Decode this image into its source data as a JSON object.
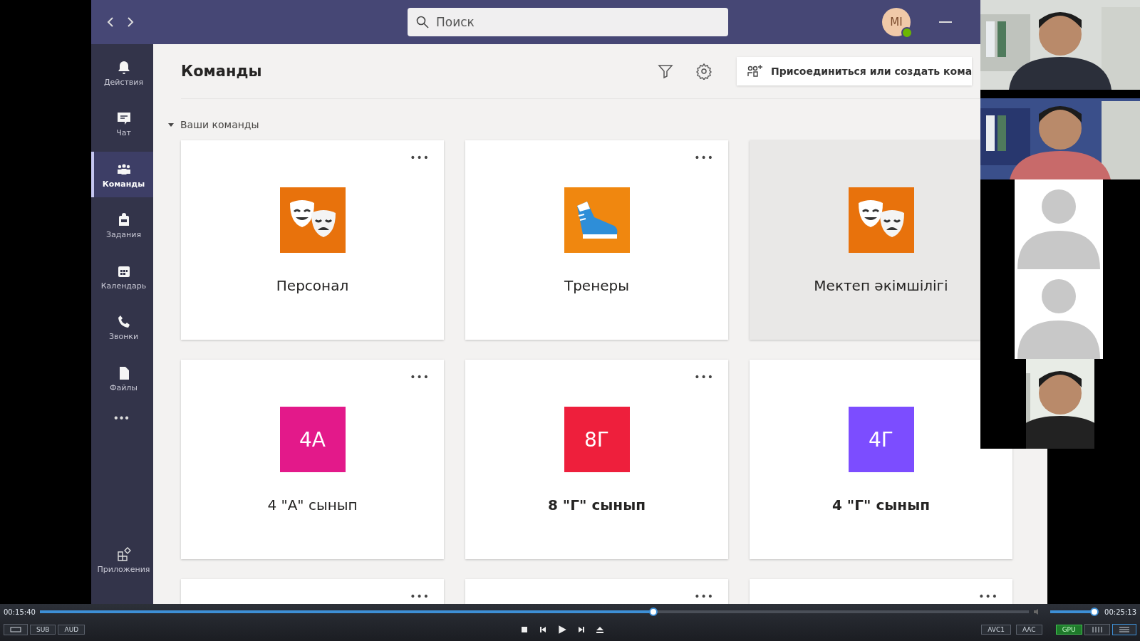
{
  "top_bar": {
    "search": {
      "placeholder": "Поиск"
    },
    "avatar": {
      "initials": "MI",
      "online": true
    }
  },
  "sidebar": {
    "items": [
      {
        "label": "Действия",
        "selected": false
      },
      {
        "label": "Чат",
        "selected": false
      },
      {
        "label": "Команды",
        "selected": true
      },
      {
        "label": "Задания",
        "selected": false
      },
      {
        "label": "Календарь",
        "selected": false
      },
      {
        "label": "Звонки",
        "selected": false
      },
      {
        "label": "Файлы",
        "selected": false
      }
    ],
    "more": "•••",
    "apps": {
      "label": "Приложения"
    }
  },
  "header": {
    "title": "Команды",
    "join_button": "Присоединиться или создать кома"
  },
  "section": {
    "title": "Ваши команды",
    "expanded": true
  },
  "teams": [
    {
      "name": "Персонал",
      "more": "•••",
      "kind": "masks",
      "color": "#e8720c",
      "bold": false,
      "hovered": false
    },
    {
      "name": "Тренеры",
      "more": "•••",
      "kind": "sneaker",
      "color": "#f0870f",
      "bold": false,
      "hovered": false
    },
    {
      "name": "Мектеп әкімшілігі",
      "kind": "masks",
      "color": "#e8720c",
      "bold": false,
      "hovered": true
    },
    {
      "name": "4 \"А\" сынып",
      "more": "•••",
      "kind": "initials",
      "tile": "4А",
      "color": "#e3198a",
      "bold": false,
      "hovered": false
    },
    {
      "name": "8 \"Г\" сынып",
      "more": "•••",
      "kind": "initials",
      "tile": "8Г",
      "color": "#ee1f3c",
      "bold": true,
      "hovered": false
    },
    {
      "name": "4 \"Г\" сынып",
      "kind": "initials",
      "tile": "4Г",
      "color": "#7c4dff",
      "bold": true,
      "hovered": false
    }
  ],
  "partial_cards": [
    {
      "more": "•••"
    },
    {
      "more": "•••"
    },
    {
      "more": "•••"
    }
  ],
  "videos": [
    {
      "kind": "picture"
    },
    {
      "kind": "picture"
    },
    {
      "kind": "avatar"
    },
    {
      "kind": "avatar"
    },
    {
      "kind": "picture"
    }
  ],
  "player": {
    "elapsed": "00:15:40",
    "total": "00:25:13",
    "progress": {
      "level": 0.62
    },
    "volume": {
      "level": 0.97
    },
    "left_buttons": [
      "SUB",
      "AUD"
    ],
    "right_buttons": [
      {
        "label": "AVC1",
        "on": false
      },
      {
        "label": "AAC",
        "on": false
      },
      {
        "label": "GPU",
        "on": true
      }
    ]
  }
}
